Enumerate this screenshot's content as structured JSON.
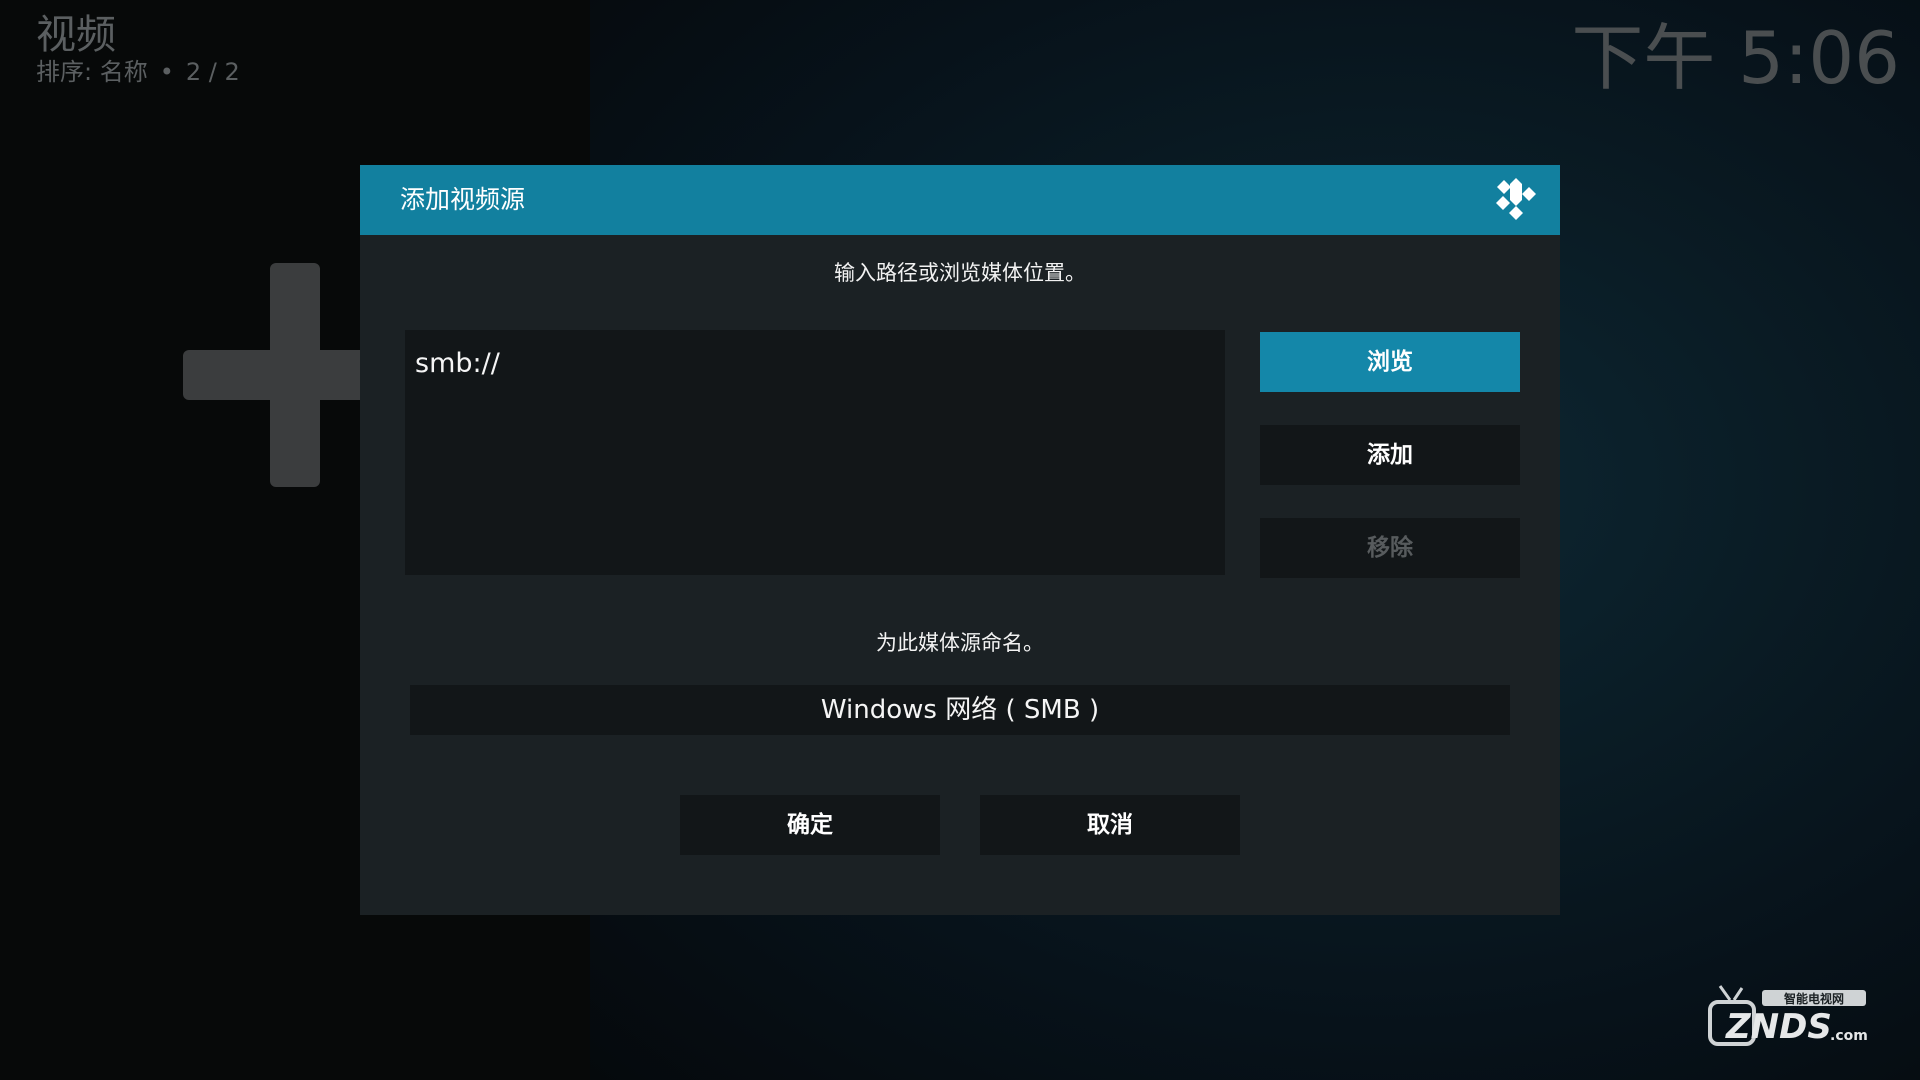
{
  "header": {
    "title": "视频",
    "sort_label": "排序: 名称",
    "separator": "•",
    "page_count": "2 / 2"
  },
  "clock": {
    "time": "下午 5:06"
  },
  "dialog": {
    "title": "添加视频源",
    "path_prompt": "输入路径或浏览媒体位置。",
    "path_value": "smb://",
    "buttons": {
      "browse": "浏览",
      "add": "添加",
      "remove": "移除"
    },
    "name_prompt": "为此媒体源命名。",
    "name_value": "Windows 网络 ( SMB )",
    "ok": "确定",
    "cancel": "取消"
  },
  "watermark": {
    "brand": "ZNDS",
    "suffix": ".com",
    "tagline": "智能电视网"
  },
  "colors": {
    "accent": "#12809f",
    "dialog_bg": "#1b2124",
    "field_bg": "#121618"
  }
}
